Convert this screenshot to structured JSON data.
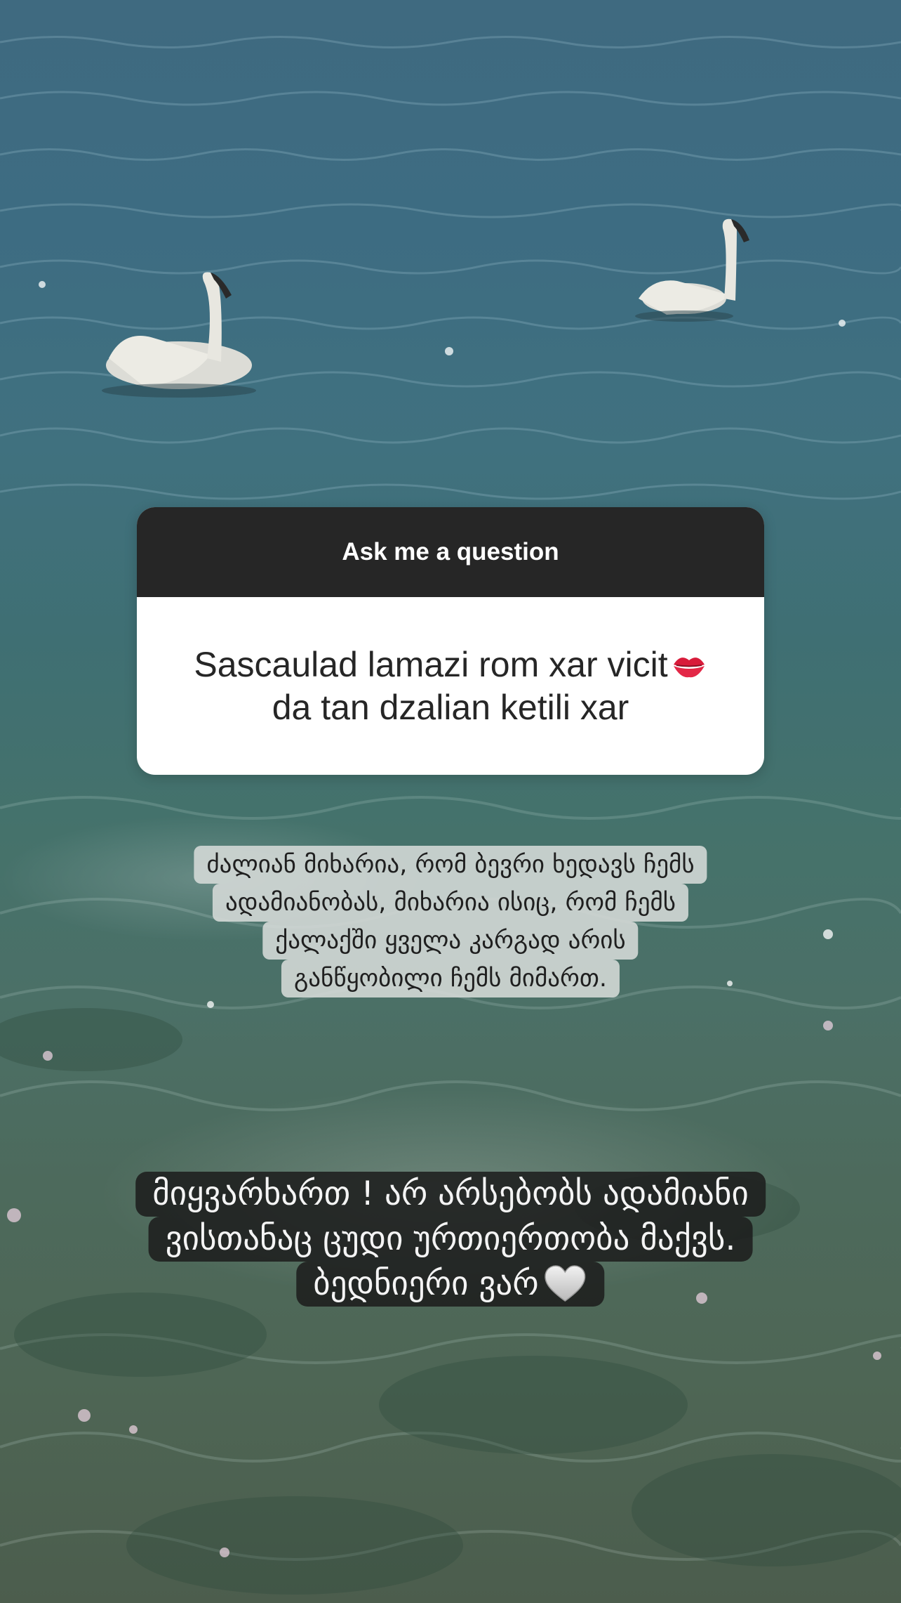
{
  "question_sticker": {
    "header": "Ask me a question",
    "question_line_1": "Sascaulad lamazi rom xar vicit",
    "question_line_2": "da tan dzalian ketili xar",
    "emoji": "kiss-mark-icon"
  },
  "answer_1": {
    "lines": [
      "ძალიან მიხარია, რომ ბევრი ხედავს ჩემს",
      "ადამიანობას, მიხარია ისიც, რომ ჩემს",
      "ქალაქში ყველა კარგად არის",
      "განწყობილი ჩემს მიმართ."
    ]
  },
  "answer_2": {
    "lines": [
      "მიყვარხართ ! არ არსებობს ადამიანი",
      "ვისთანაც ცუდი ურთიერთობა მაქვს.",
      "ბედნიერი ვარ"
    ],
    "emoji": "white-heart-icon"
  },
  "colors": {
    "sticker_header": "#262626",
    "sticker_body": "#ffffff",
    "water": "#3f6f78"
  }
}
